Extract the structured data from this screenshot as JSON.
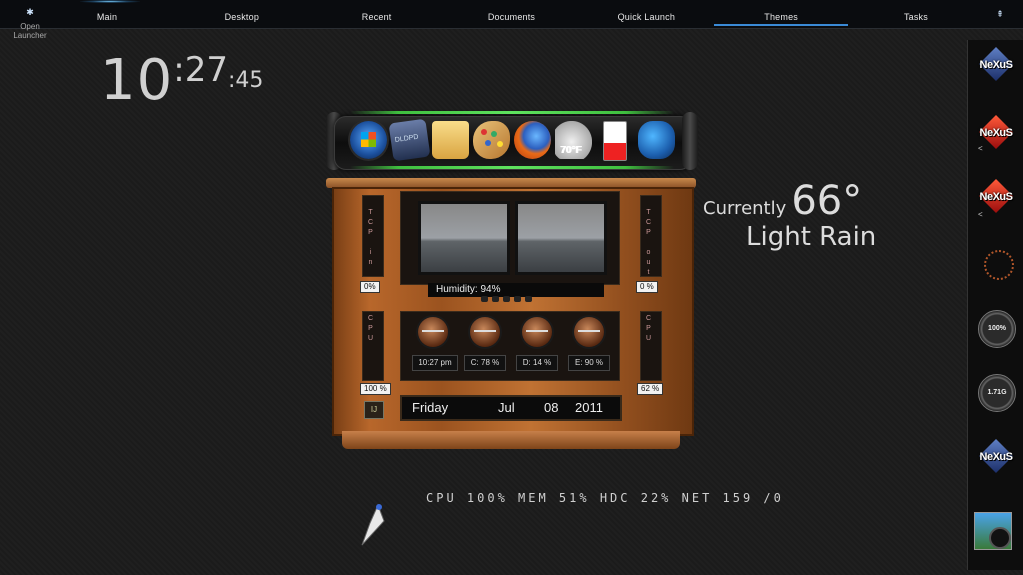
{
  "launcher": {
    "label": "Open Launcher",
    "icon": "gear-icon"
  },
  "tabs": [
    "Main",
    "Desktop",
    "Recent",
    "Documents",
    "Quick Launch",
    "Themes",
    "Tasks"
  ],
  "active_tab": "Main",
  "clock": {
    "hours": "10",
    "minutes": ":27",
    "seconds": ":45"
  },
  "weather": {
    "prefix": "Currently",
    "temp": "66°",
    "condition": "Light Rain"
  },
  "dock": {
    "icons": [
      "windows-start-icon",
      "droid-icon",
      "folder-icon",
      "paint-palette-icon",
      "firefox-icon",
      "weather-cloud-icon",
      "battery-icon",
      "settings-gear-icon"
    ],
    "weather_icon_temp": "70°F"
  },
  "cabinet": {
    "tcp_in_label": "TCP in",
    "tcp_out_label": "TCP out",
    "tcp_in_pct": "0%",
    "tcp_out_pct": "0 %",
    "cpu1_label": "CPU",
    "cpu2_label": "CPU",
    "cpu1_pct": "100 %",
    "cpu2_pct": "62 %",
    "humidity": "Humidity: 94%",
    "slots": [
      "10:27 pm",
      "C: 78 %",
      "D: 14 %",
      "E: 90 %"
    ],
    "date": {
      "day": "Friday",
      "month": "Jul",
      "date": "08",
      "year": "2011"
    }
  },
  "stats": "CPU 100% MEM 51% HDC 22% NET 159 /0",
  "sidebar": {
    "items": [
      "nexus-logo",
      "nexus-logo-red",
      "nexus-logo-red",
      "dotted-ring",
      "dial-1",
      "dial-2",
      "nexus-logo",
      "camera"
    ],
    "dial_1_value": "100%",
    "dial_2_value": "1.71G"
  },
  "colors": {
    "accent_blue": "#3a8ad6",
    "dock_glow": "#5fe35f",
    "wood": "#b8672b",
    "nexus_red": "#c41e1e",
    "nexus_blue": "#2a4fa0"
  }
}
